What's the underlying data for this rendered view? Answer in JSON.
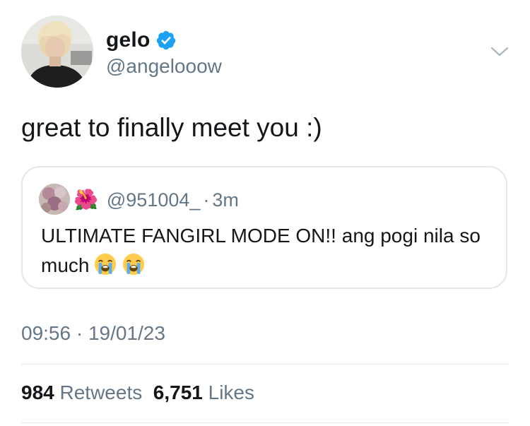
{
  "author": {
    "display_name": "gelo",
    "handle": "@angelooow",
    "verified": true,
    "verified_color": "#1da1f2"
  },
  "tweet": {
    "text": "great to finally meet you :)",
    "timestamp": "09:56 · 19/01/23"
  },
  "quote": {
    "name_emoji": "🌺",
    "handle": "@951004_",
    "separator": "·",
    "time": "3m",
    "text": "ULTIMATE FANGIRL MODE ON!! ang pogi nila so much",
    "trailing_emoji": [
      "loudly-crying-face",
      "loudly-crying-face"
    ]
  },
  "stats": {
    "retweets_count": "984",
    "retweets_label": "Retweets",
    "likes_count": "6,751",
    "likes_label": "Likes"
  },
  "colors": {
    "text_primary": "#14171a",
    "text_secondary": "#657786",
    "border": "#e1e8ed"
  }
}
